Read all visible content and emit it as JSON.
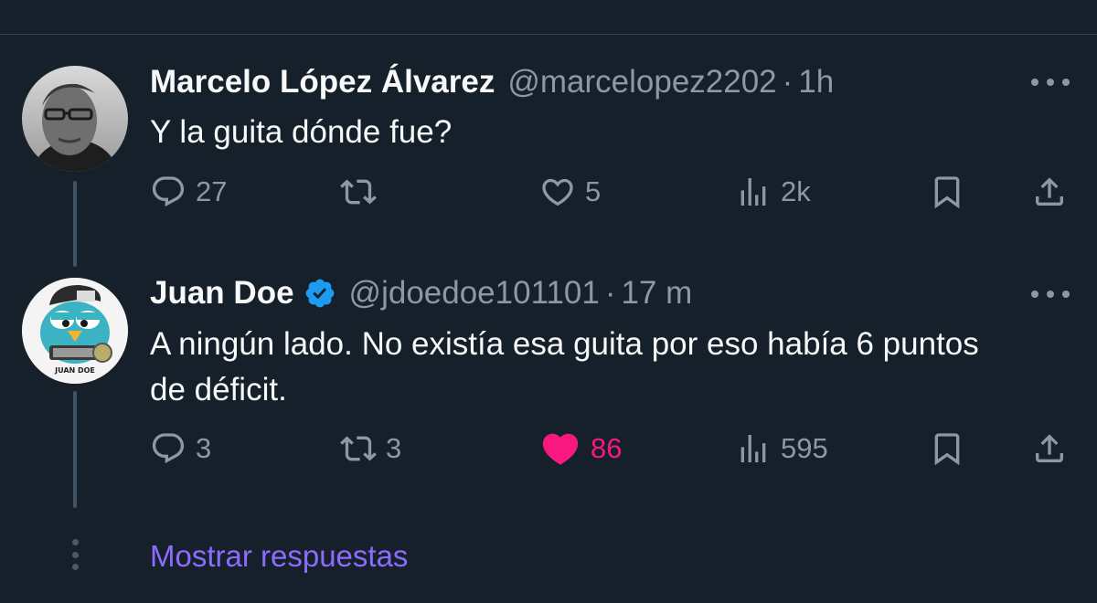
{
  "tweets": [
    {
      "name": "Marcelo López Álvarez",
      "handle": "@marcelopez2202",
      "separator": "·",
      "time": "1h",
      "verified": false,
      "text": "Y la guita dónde fue?",
      "actions": {
        "replies": "27",
        "retweets": "",
        "likes": "5",
        "views": "2k"
      },
      "liked": false
    },
    {
      "name": "Juan Doe",
      "handle": "@jdoedoe101101",
      "separator": "·",
      "time": "17 m",
      "verified": true,
      "text": "A ningún lado. No existía esa guita por eso había 6 puntos de déficit.",
      "actions": {
        "replies": "3",
        "retweets": "3",
        "likes": "86",
        "views": "595"
      },
      "liked": true,
      "avatar_caption": "JUAN DOE"
    }
  ],
  "show_replies_label": "Mostrar respuestas",
  "colors": {
    "background": "#15202b",
    "text": "#f7f9f9",
    "secondary": "#8b98a5",
    "like": "#f91880",
    "link": "#8c6bff",
    "verified": "#1d9bf0"
  },
  "icons": [
    "reply-icon",
    "retweet-icon",
    "heart-icon",
    "views-icon",
    "bookmark-icon",
    "share-icon",
    "more-icon",
    "verified-icon"
  ]
}
